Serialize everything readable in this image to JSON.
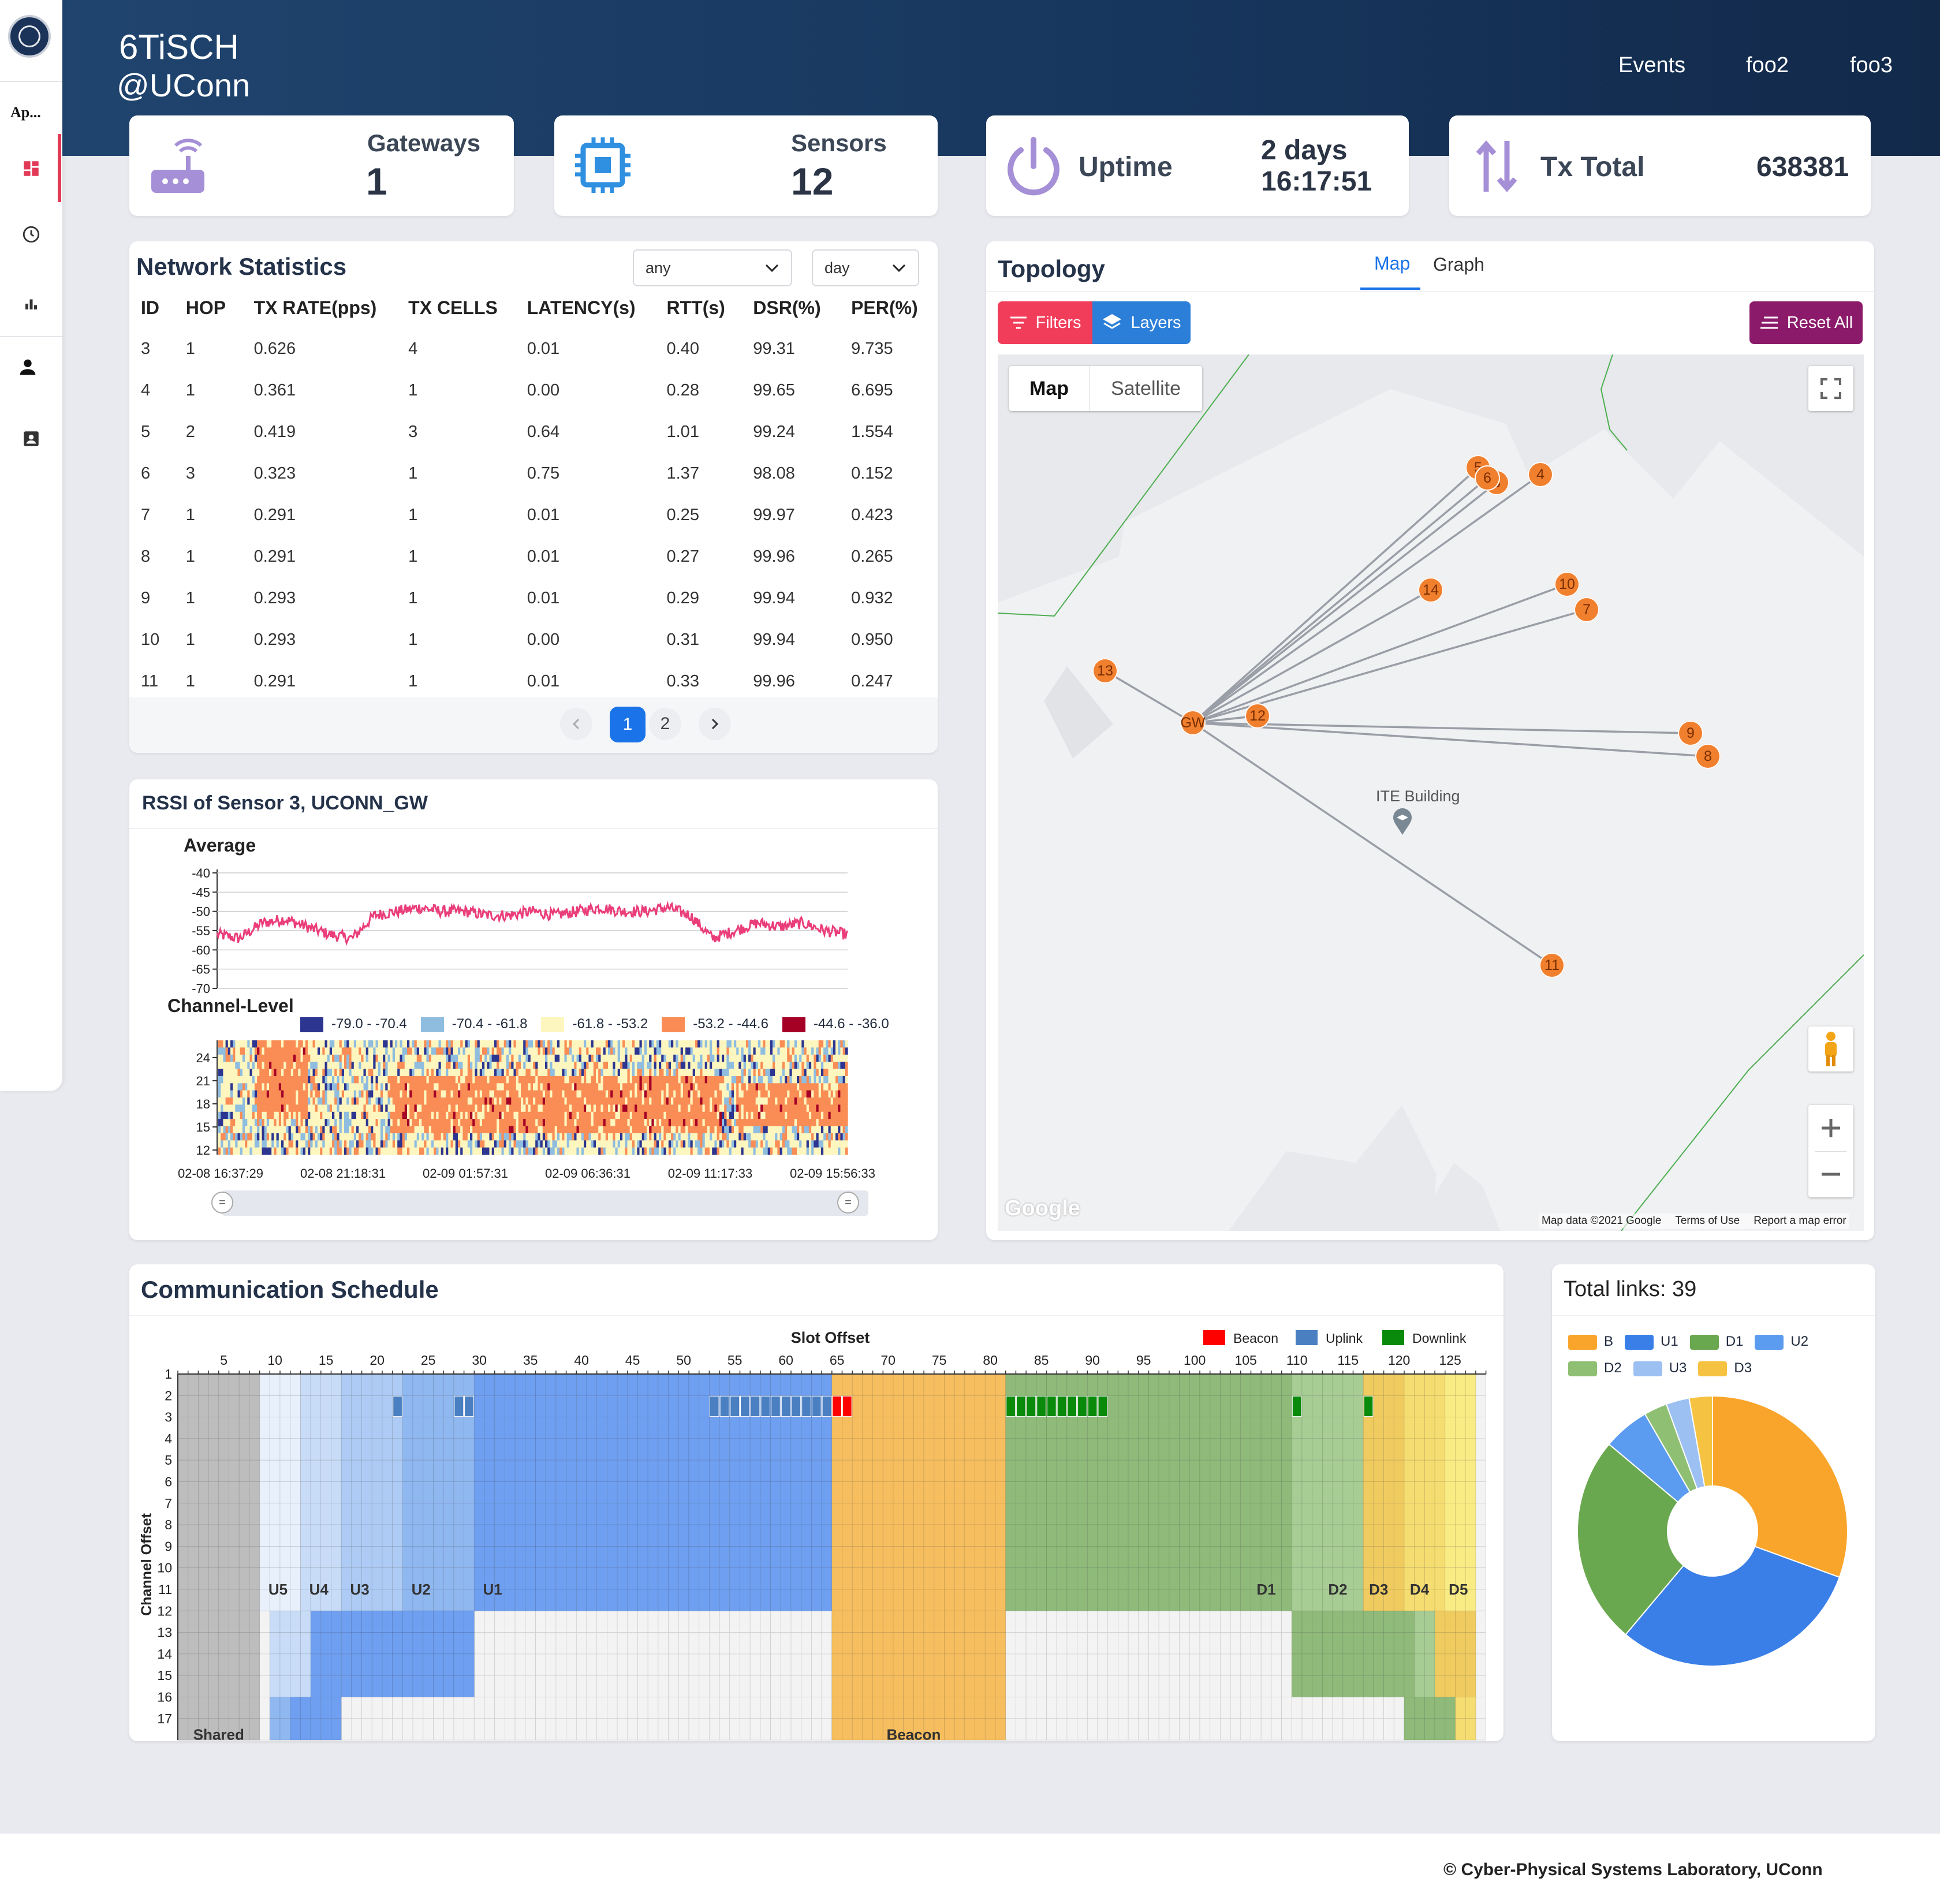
{
  "header": {
    "brand_line1": "6TiSCH",
    "brand_line2": "@UConn",
    "nav": [
      "Events",
      "foo2",
      "foo3"
    ]
  },
  "sidebar": {
    "app_label": "Ap...",
    "items": [
      "dashboard-icon",
      "clock-icon",
      "bar-chart-icon",
      "person-icon",
      "contact-card-icon"
    ]
  },
  "stats": {
    "gateways": {
      "label": "Gateways",
      "value": "1"
    },
    "sensors": {
      "label": "Sensors",
      "value": "12"
    },
    "uptime": {
      "label": "Uptime",
      "value_line1": "2 days",
      "value_line2": "16:17:51"
    },
    "tx_total": {
      "label": "Tx Total",
      "value": "638381"
    }
  },
  "network_stats": {
    "title": "Network Statistics",
    "filter1": "any",
    "filter2": "day",
    "columns": [
      "ID",
      "HOP",
      "TX RATE(pps)",
      "TX CELLS",
      "LATENCY(s)",
      "RTT(s)",
      "DSR(%)",
      "PER(%)"
    ],
    "rows": [
      [
        "3",
        "1",
        "0.626",
        "4",
        "0.01",
        "0.40",
        "99.31",
        "9.735"
      ],
      [
        "4",
        "1",
        "0.361",
        "1",
        "0.00",
        "0.28",
        "99.65",
        "6.695"
      ],
      [
        "5",
        "2",
        "0.419",
        "3",
        "0.64",
        "1.01",
        "99.24",
        "1.554"
      ],
      [
        "6",
        "3",
        "0.323",
        "1",
        "0.75",
        "1.37",
        "98.08",
        "0.152"
      ],
      [
        "7",
        "1",
        "0.291",
        "1",
        "0.01",
        "0.25",
        "99.97",
        "0.423"
      ],
      [
        "8",
        "1",
        "0.291",
        "1",
        "0.01",
        "0.27",
        "99.96",
        "0.265"
      ],
      [
        "9",
        "1",
        "0.293",
        "1",
        "0.01",
        "0.29",
        "99.94",
        "0.932"
      ],
      [
        "10",
        "1",
        "0.293",
        "1",
        "0.00",
        "0.31",
        "99.94",
        "0.950"
      ],
      [
        "11",
        "1",
        "0.291",
        "1",
        "0.01",
        "0.33",
        "99.96",
        "0.247"
      ]
    ],
    "pages": [
      "1",
      "2"
    ],
    "current_page": "1"
  },
  "rssi": {
    "title": "RSSI of Sensor 3, UCONN_GW",
    "average_label": "Average",
    "channel_label": "Channel-Level",
    "legend": [
      "-79.0 - -70.4",
      "-70.4 - -61.8",
      "-61.8 - -53.2",
      "-53.2 - -44.6",
      "-44.6 - -36.0"
    ],
    "legend_colors": [
      "#2c3590",
      "#8fbde0",
      "#fdf6bf",
      "#f98d55",
      "#a50026"
    ],
    "time_labels": [
      "02-08 16:37:29",
      "02-08 21:18:31",
      "02-09 01:57:31",
      "02-09 06:36:31",
      "02-09 11:17:33",
      "02-09 15:56:33"
    ]
  },
  "chart_data": [
    {
      "type": "line",
      "title": "Average",
      "y_ticks": [
        -40,
        -45,
        -50,
        -55,
        -60,
        -65,
        -70
      ],
      "ylim": [
        -70,
        -40
      ],
      "series": [
        {
          "values": [
            -56,
            -57,
            -53,
            -52,
            -54,
            -56,
            -57,
            -51,
            -50,
            -49,
            -50,
            -50,
            -51,
            -51,
            -50,
            -51,
            -50,
            -49,
            -50,
            -50,
            -49,
            -51,
            -57,
            -55,
            -53,
            -54,
            -53,
            -55,
            -56
          ]
        }
      ]
    },
    {
      "type": "heatmap",
      "title": "Channel-Level",
      "y_ticks": [
        12,
        15,
        18,
        21,
        24
      ],
      "x_ticks": [
        "02-08 16:37:29",
        "02-08 21:18:31",
        "02-09 01:57:31",
        "02-09 06:36:31",
        "02-09 11:17:33",
        "02-09 15:56:33"
      ]
    },
    {
      "type": "heatmap",
      "title": "Slot Offset",
      "xlabel": "Slot Offset",
      "ylabel": "Channel Offset",
      "x_ticks": [
        5,
        10,
        15,
        20,
        25,
        30,
        35,
        40,
        45,
        50,
        55,
        60,
        65,
        70,
        75,
        80,
        85,
        90,
        95,
        100,
        105,
        110,
        115,
        120,
        125
      ],
      "y_ticks": [
        1,
        2,
        3,
        4,
        5,
        6,
        7,
        8,
        9,
        10,
        11,
        12,
        13,
        14,
        15,
        16,
        17
      ],
      "legend": [
        "Beacon",
        "Uplink",
        "Downlink"
      ],
      "legend_colors": [
        "#ff0000",
        "#4a7fc1",
        "#0a8a0a"
      ],
      "region_labels": [
        "U5",
        "U4",
        "U3",
        "U2",
        "U1",
        "D1",
        "D2",
        "D3",
        "D4",
        "D5",
        "Shared",
        "Beacon"
      ]
    },
    {
      "type": "pie",
      "title": "Total links: 39",
      "categories": [
        "B",
        "U1",
        "D1",
        "U2",
        "D2",
        "U3",
        "D3"
      ],
      "values": [
        11,
        11,
        9,
        2,
        1,
        1,
        1
      ],
      "colors": [
        "#f9a52b",
        "#3a7fe8",
        "#6aa84f",
        "#5b9cf0",
        "#8fbf73",
        "#9cc0f2",
        "#f5c242"
      ]
    }
  ],
  "topology": {
    "title": "Topology",
    "tabs": [
      "Map",
      "Graph"
    ],
    "active_tab": "Map",
    "filters_label": "Filters",
    "layers_label": "Layers",
    "reset_label": "Reset All",
    "map_types": [
      "Map",
      "Satellite"
    ],
    "building_label": "ITE Building",
    "nodes": [
      "GW",
      "3",
      "4",
      "5",
      "6",
      "7",
      "8",
      "9",
      "10",
      "11",
      "12",
      "13",
      "14"
    ],
    "attribution": [
      "Map data ©2021 Google",
      "Terms of Use",
      "Report a map error"
    ],
    "google": "Google"
  },
  "schedule": {
    "title": "Communication Schedule"
  },
  "links": {
    "title": "Total links: 39"
  },
  "footer": {
    "text": "© Cyber-Physical Systems Laboratory, UConn"
  }
}
